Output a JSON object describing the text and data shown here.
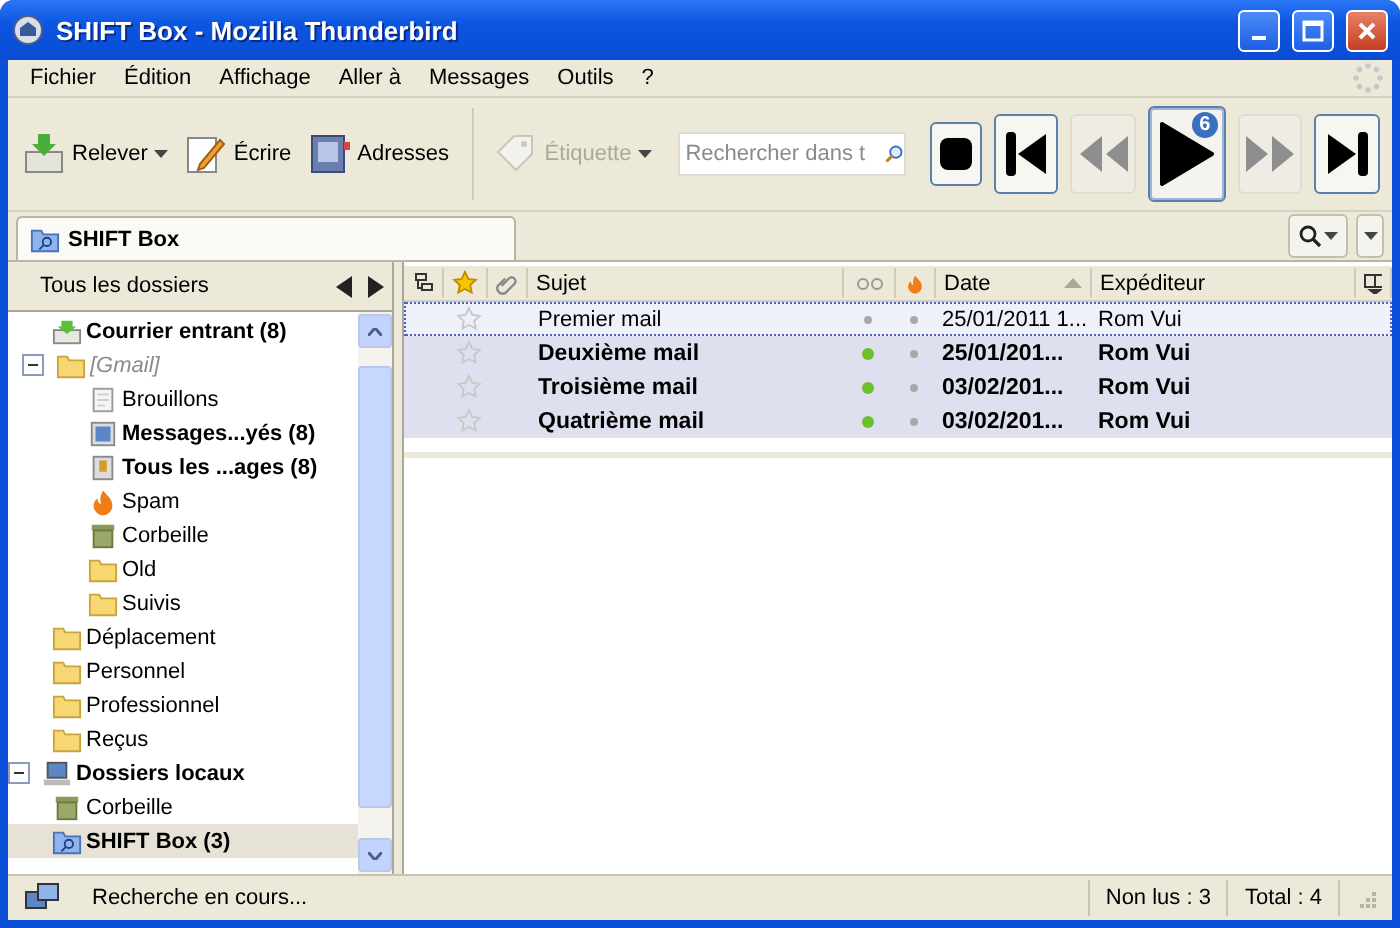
{
  "window": {
    "title": "SHIFT Box - Mozilla Thunderbird"
  },
  "menu": [
    "Fichier",
    "Édition",
    "Affichage",
    "Aller à",
    "Messages",
    "Outils",
    "?"
  ],
  "toolbar": [
    {
      "label": "Relever",
      "kind": "get",
      "dropdown": true,
      "disabled": false
    },
    {
      "label": "Écrire",
      "kind": "write",
      "dropdown": false,
      "disabled": false
    },
    {
      "label": "Adresses",
      "kind": "book",
      "dropdown": false,
      "disabled": false
    },
    {
      "label": "Étiquette",
      "kind": "tag",
      "dropdown": true,
      "disabled": true
    }
  ],
  "search": {
    "placeholder": "Rechercher dans t"
  },
  "media": [
    {
      "kind": "stop",
      "disabled": false,
      "selected": false
    },
    {
      "kind": "first",
      "disabled": false,
      "selected": false
    },
    {
      "kind": "rewind",
      "disabled": true,
      "selected": false
    },
    {
      "kind": "play",
      "disabled": false,
      "selected": true,
      "badge": "6"
    },
    {
      "kind": "forward",
      "disabled": true,
      "selected": false
    },
    {
      "kind": "last",
      "disabled": false,
      "selected": false
    }
  ],
  "tab": {
    "label": "SHIFT Box"
  },
  "folder_pane": {
    "header": "Tous les dossiers",
    "folders": [
      {
        "children": [
          {
            "label": "Courrier entrant (8)",
            "kind": "inbox",
            "unread": true,
            "selected": false
          },
          {
            "label": "[Gmail]",
            "kind": "folder",
            "unread": false,
            "selected": false,
            "expanded": true,
            "italic": true,
            "children": [
              {
                "label": "Brouillons",
                "kind": "drafts",
                "unread": false,
                "selected": false
              },
              {
                "label": "Messages...yés (8)",
                "kind": "sent",
                "unread": true,
                "selected": false
              },
              {
                "label": "Tous les ...ages (8)",
                "kind": "archive",
                "unread": true,
                "selected": false
              },
              {
                "label": "Spam",
                "kind": "spam",
                "unread": false,
                "selected": false
              },
              {
                "label": "Corbeille",
                "kind": "trash",
                "unread": false,
                "selected": false
              },
              {
                "label": "Old",
                "kind": "folder",
                "unread": false,
                "selected": false
              },
              {
                "label": "Suivis",
                "kind": "folder",
                "unread": false,
                "selected": false
              }
            ]
          },
          {
            "label": "Déplacement",
            "kind": "folder",
            "unread": false,
            "selected": false
          },
          {
            "label": "Personnel",
            "kind": "folder",
            "unread": false,
            "selected": false
          },
          {
            "label": "Professionnel",
            "kind": "folder",
            "unread": false,
            "selected": false
          },
          {
            "label": "Reçus",
            "kind": "folder",
            "unread": false,
            "selected": false
          }
        ]
      },
      {
        "label": "Dossiers locaux",
        "kind": "computer",
        "unread": true,
        "selected": false,
        "expanded": true,
        "children": [
          {
            "label": "Corbeille",
            "kind": "trash",
            "unread": false,
            "selected": false
          },
          {
            "label": "SHIFT Box (3)",
            "kind": "search",
            "unread": true,
            "selected": true
          }
        ]
      }
    ]
  },
  "message_list": {
    "columns": {
      "subject": "Sujet",
      "date": "Date",
      "sender": "Expéditeur"
    },
    "rows": [
      {
        "subject": "Premier mail",
        "date": "25/01/2011 1...",
        "sender": "Rom Vui",
        "unread": false,
        "starred": false,
        "focused": true
      },
      {
        "subject": "Deuxième mail",
        "date": "25/01/201...",
        "sender": "Rom Vui",
        "unread": true,
        "starred": false,
        "focused": false
      },
      {
        "subject": "Troisième mail",
        "date": "03/02/201...",
        "sender": "Rom Vui",
        "unread": true,
        "starred": false,
        "focused": false
      },
      {
        "subject": "Quatrième mail",
        "date": "03/02/201...",
        "sender": "Rom Vui",
        "unread": true,
        "starred": false,
        "focused": false
      }
    ]
  },
  "status_bar": {
    "text": "Recherche en cours...",
    "unread": "Non lus : 3",
    "total": "Total : 4"
  }
}
